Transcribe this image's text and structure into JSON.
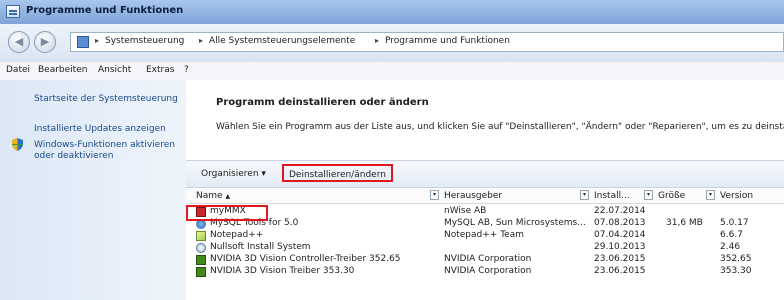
{
  "window": {
    "title": "Programme und Funktionen"
  },
  "nav": {
    "back_icon": "back-arrow-icon",
    "forward_icon": "forward-arrow-icon",
    "breadcrumb": [
      "Systemsteuerung",
      "Alle Systemsteuerungselemente",
      "Programme und Funktionen"
    ]
  },
  "menu": {
    "items": [
      "Datei",
      "Bearbeiten",
      "Ansicht",
      "Extras",
      "?"
    ]
  },
  "sidebar": {
    "home_link": "Startseite der Systemsteuerung",
    "updates_link": "Installierte Updates anzeigen",
    "features_link_line1": "Windows-Funktionen aktivieren",
    "features_link_line2": "oder deaktivieren"
  },
  "main": {
    "heading": "Programm deinstallieren oder ändern",
    "description": "Wählen Sie ein Programm aus der Liste aus, und klicken Sie auf \"Deinstallieren\", \"Ändern\" oder \"Reparieren\", um es zu deinstallieren"
  },
  "toolbar": {
    "organize": "Organisieren",
    "uninstall": "Deinstallieren/ändern"
  },
  "table": {
    "columns": [
      "Name",
      "Herausgeber",
      "Install...",
      "Größe",
      "Version"
    ],
    "rows": [
      {
        "name": "myMMX",
        "publisher": "nWise AB",
        "installed": "22.07.2014",
        "size": "",
        "version": "",
        "icon": "mymmx-icon"
      },
      {
        "name": "MySQL Tools for 5.0",
        "publisher": "MySQL AB, Sun Microsystems...",
        "installed": "07.08.2013",
        "size": "31,6 MB",
        "version": "5.0.17",
        "icon": "mysql-icon"
      },
      {
        "name": "Notepad++",
        "publisher": "Notepad++ Team",
        "installed": "07.04.2014",
        "size": "",
        "version": "6.6.7",
        "icon": "notepad-icon"
      },
      {
        "name": "Nullsoft Install System",
        "publisher": "",
        "installed": "29.10.2013",
        "size": "",
        "version": "2.46",
        "icon": "nullsoft-icon"
      },
      {
        "name": "NVIDIA 3D Vision Controller-Treiber 352.65",
        "publisher": "NVIDIA Corporation",
        "installed": "23.06.2015",
        "size": "",
        "version": "352.65",
        "icon": "nvidia-icon"
      },
      {
        "name": "NVIDIA 3D Vision Treiber 353.30",
        "publisher": "NVIDIA Corporation",
        "installed": "23.06.2015",
        "size": "",
        "version": "353.30",
        "icon": "nvidia-icon"
      }
    ]
  },
  "colors": {
    "highlight": "#e0181f",
    "link": "#1a4a8c",
    "nvidia": "#3f8a1a"
  }
}
